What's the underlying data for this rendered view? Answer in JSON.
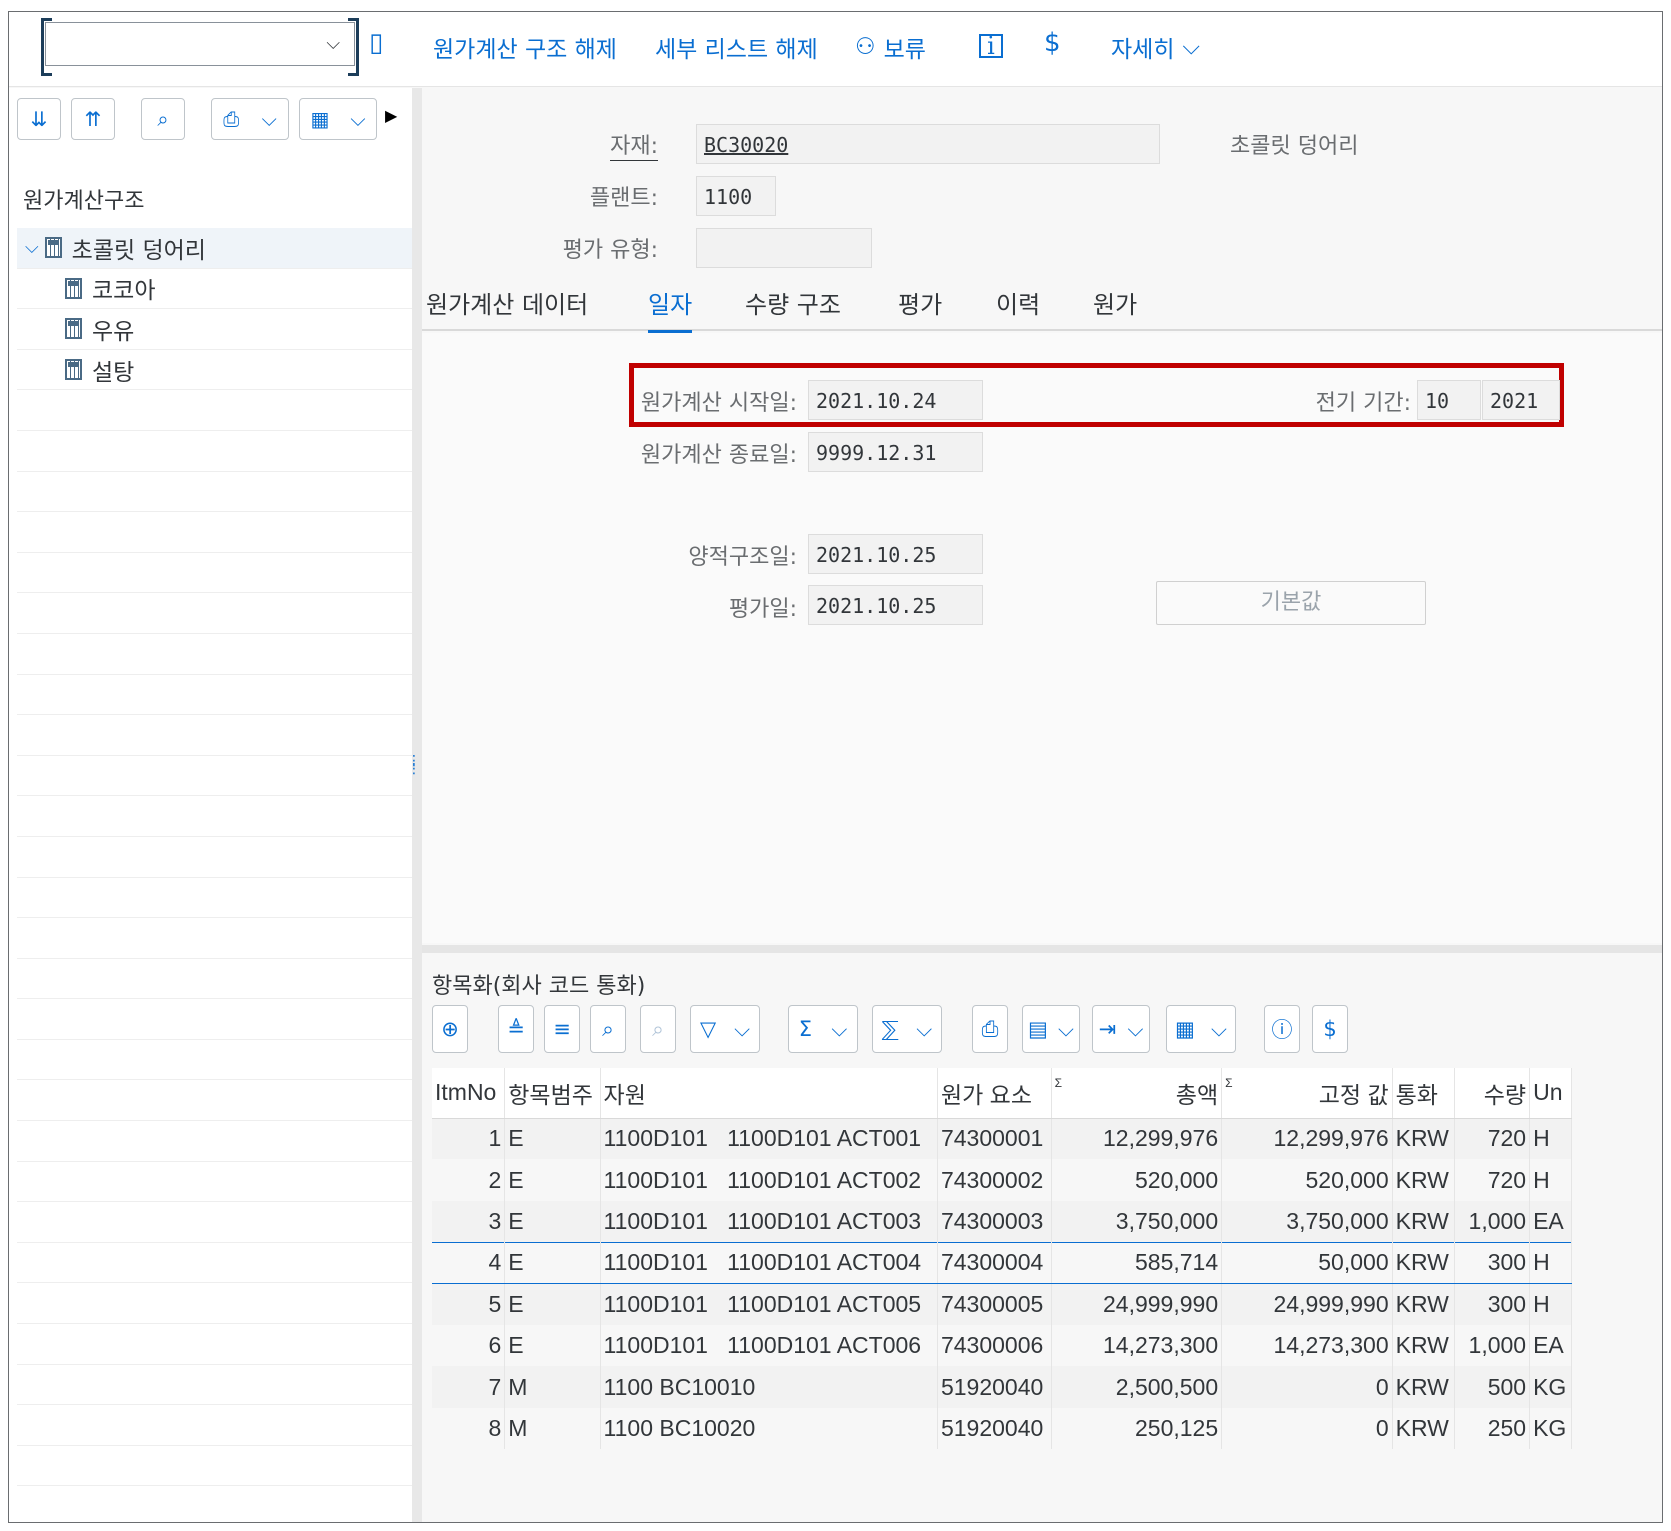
{
  "toolbar": {
    "items": [
      "원가계산 구조 해제",
      "세부 리스트 해제",
      "보류",
      "자세히"
    ]
  },
  "left_panel": {
    "title": "원가계산구조",
    "tree": [
      {
        "label": "초콜릿 덩어리",
        "level": 0,
        "expanded": true
      },
      {
        "label": "코코아",
        "level": 1
      },
      {
        "label": "우유",
        "level": 1
      },
      {
        "label": "설탕",
        "level": 1
      }
    ]
  },
  "header_fields": {
    "material_label": "자재:",
    "material_value": "BC30020",
    "material_desc": "초콜릿 덩어리",
    "plant_label": "플랜트:",
    "plant_value": "1100",
    "valuation_type_label": "평가 유형:",
    "valuation_type_value": ""
  },
  "tabs": [
    "원가계산 데이터",
    "일자",
    "수량 구조",
    "평가",
    "이력",
    "원가"
  ],
  "active_tab": "일자",
  "dates": {
    "start_label": "원가계산 시작일:",
    "start_value": "2021.10.24",
    "period_label": "전기 기간:",
    "period_month": "10",
    "period_year": "2021",
    "end_label": "원가계산 종료일:",
    "end_value": "9999.12.31",
    "qty_struct_label": "양적구조일:",
    "qty_struct_value": "2021.10.25",
    "valuation_label": "평가일:",
    "valuation_value": "2021.10.25",
    "default_button": "기본값"
  },
  "itemization": {
    "title": "항목화(회사 코드 통화)",
    "columns": [
      "ItmNo",
      "항목범주",
      "자원",
      "원가 요소",
      "총액",
      "고정 값",
      "통화",
      "수량",
      "Un"
    ],
    "rows": [
      [
        "1",
        "E",
        "1100D101   1100D101 ACT001",
        "74300001",
        "12,299,976",
        "12,299,976",
        "KRW",
        "720",
        "H"
      ],
      [
        "2",
        "E",
        "1100D101   1100D101 ACT002",
        "74300002",
        "520,000",
        "520,000",
        "KRW",
        "720",
        "H"
      ],
      [
        "3",
        "E",
        "1100D101   1100D101 ACT003",
        "74300003",
        "3,750,000",
        "3,750,000",
        "KRW",
        "1,000",
        "EA"
      ],
      [
        "4",
        "E",
        "1100D101   1100D101 ACT004",
        "74300004",
        "585,714",
        "50,000",
        "KRW",
        "300",
        "H"
      ],
      [
        "5",
        "E",
        "1100D101   1100D101 ACT005",
        "74300005",
        "24,999,990",
        "24,999,990",
        "KRW",
        "300",
        "H"
      ],
      [
        "6",
        "E",
        "1100D101   1100D101 ACT006",
        "74300006",
        "14,273,300",
        "14,273,300",
        "KRW",
        "1,000",
        "EA"
      ],
      [
        "7",
        "M",
        "1100 BC10010",
        "51920040",
        "2,500,500",
        "0",
        "KRW",
        "500",
        "KG"
      ],
      [
        "8",
        "M",
        "1100 BC10020",
        "51920040",
        "250,125",
        "0",
        "KRW",
        "250",
        "KG"
      ]
    ]
  },
  "colors": {
    "accent": "#0a6ed1",
    "highlight_border": "#c00000"
  }
}
